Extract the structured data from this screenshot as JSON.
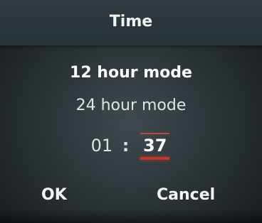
{
  "title": "Time",
  "options": [
    {
      "label": "12 hour mode",
      "selected": true
    },
    {
      "label": "24 hour mode",
      "selected": false
    }
  ],
  "time": {
    "hour": "01",
    "separator": ":",
    "minute": "37",
    "active_field": "minute"
  },
  "buttons": {
    "ok": "OK",
    "cancel": "Cancel"
  },
  "colors": {
    "background": "#2c3438",
    "accent": "#c0392b",
    "text": "#ffffff"
  }
}
